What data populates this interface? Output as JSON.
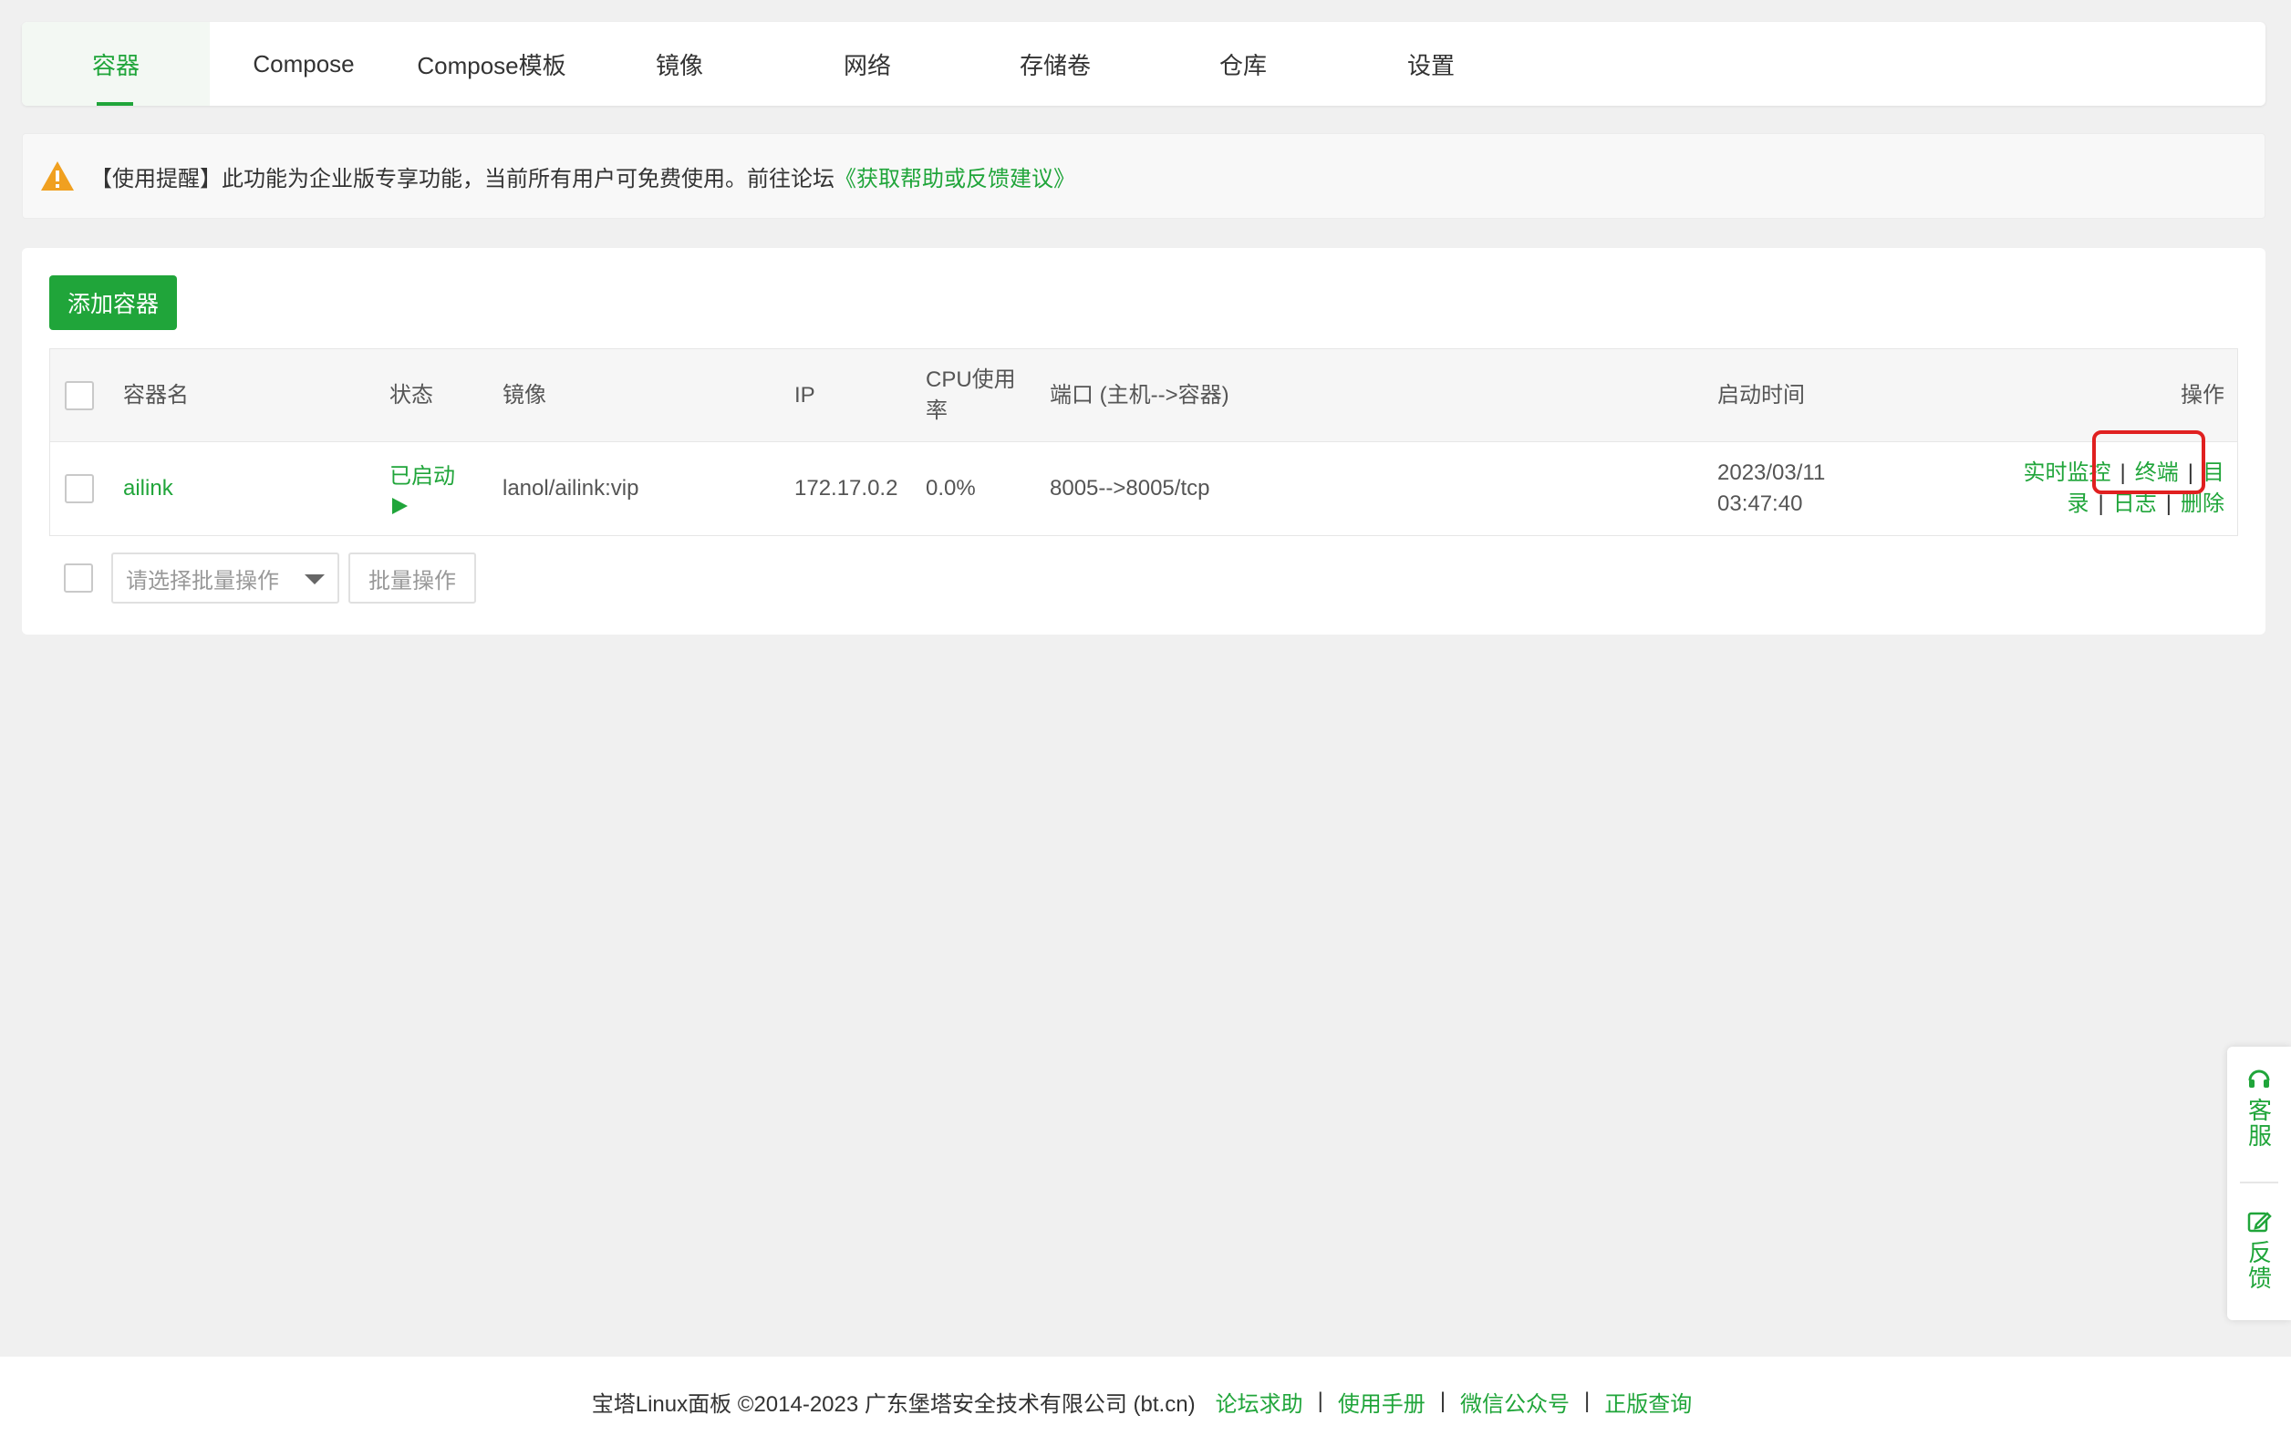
{
  "tabs": [
    {
      "label": "容器",
      "active": true
    },
    {
      "label": "Compose",
      "active": false
    },
    {
      "label": "Compose模板",
      "active": false
    },
    {
      "label": "镜像",
      "active": false
    },
    {
      "label": "网络",
      "active": false
    },
    {
      "label": "存储卷",
      "active": false
    },
    {
      "label": "仓库",
      "active": false
    },
    {
      "label": "设置",
      "active": false
    }
  ],
  "alert": {
    "icon": "warning-icon",
    "text": "【使用提醒】此功能为企业版专享功能，当前所有用户可免费使用。前往论坛",
    "link": "《获取帮助或反馈建议》"
  },
  "add_button": "添加容器",
  "table": {
    "headers": {
      "name": "容器名",
      "status": "状态",
      "image": "镜像",
      "ip": "IP",
      "cpu_line1": "CPU使用",
      "cpu_line2": "率",
      "ports": "端口 (主机-->容器)",
      "start_time": "启动时间",
      "actions": "操作"
    },
    "rows": [
      {
        "name": "ailink",
        "status": "已启动",
        "status_icon": "play-icon",
        "image": "lanol/ailink:vip",
        "ip": "172.17.0.2",
        "cpu": "0.0%",
        "ports": "8005-->8005/tcp",
        "start_date": "2023/03/11",
        "start_time": "03:47:40",
        "actions": {
          "monitor": "实时监控",
          "terminal": "终端",
          "dir_a": "目",
          "dir_b": "录",
          "logs": "日志",
          "delete": "删除",
          "sep": "|"
        }
      }
    ]
  },
  "batch": {
    "placeholder": "请选择批量操作",
    "button": "批量操作"
  },
  "side_widget": {
    "service": "客服",
    "service_icon": "headset-icon",
    "feedback": "反馈",
    "feedback_icon": "edit-icon"
  },
  "footer": {
    "copyright": "宝塔Linux面板 ©2014-2023 广东堡塔安全技术有限公司 (bt.cn)",
    "links": [
      "论坛求助",
      "使用手册",
      "微信公众号",
      "正版查询"
    ],
    "sep": "|"
  },
  "colors": {
    "accent": "#20a53a",
    "highlight": "#e02020",
    "warning": "#f0a020"
  }
}
